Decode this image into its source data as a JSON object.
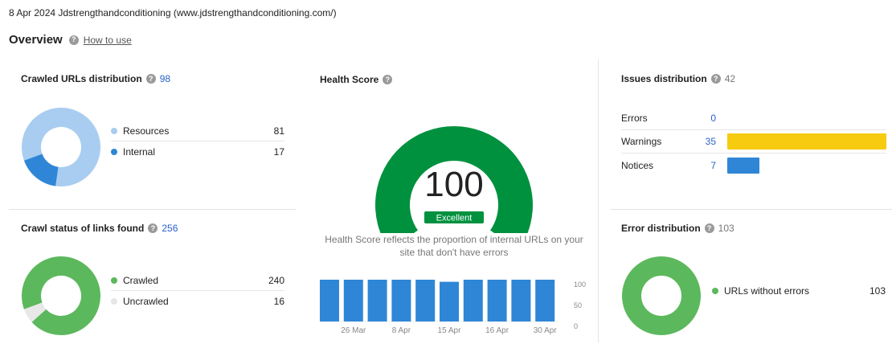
{
  "header": {
    "crawl_info": "8 Apr 2024 Jdstrengthandconditioning (www.jdstrengthandconditioning.com/)",
    "title": "Overview",
    "help_glyph": "?",
    "how_to_use": "How to use"
  },
  "crawled_urls": {
    "title": "Crawled URLs distribution",
    "count": "98",
    "items": [
      {
        "label": "Resources",
        "value": "81",
        "color": "#a9cdf0"
      },
      {
        "label": "Internal",
        "value": "17",
        "color": "#2f86d6"
      }
    ]
  },
  "crawl_status": {
    "title": "Crawl status of links found",
    "count": "256",
    "items": [
      {
        "label": "Crawled",
        "value": "240",
        "color": "#5cb85c"
      },
      {
        "label": "Uncrawled",
        "value": "16",
        "color": "#e8e8e8"
      }
    ]
  },
  "health": {
    "title": "Health Score",
    "score": "100",
    "badge": "Excellent",
    "description": "Health Score reflects the proportion of internal URLs on your site that don't have errors",
    "gauge_color": "#00913f",
    "badge_color": "#00913f",
    "history": {
      "values": [
        100,
        100,
        100,
        100,
        100,
        95,
        100,
        100,
        100,
        100
      ],
      "x_ticks": [
        "26 Mar",
        "8 Apr",
        "15 Apr",
        "16 Apr",
        "30 Apr"
      ],
      "y_ticks": [
        "100",
        "50",
        "0"
      ],
      "bar_color": "#2f86d6"
    }
  },
  "issues": {
    "title": "Issues distribution",
    "count": "42",
    "rows": [
      {
        "label": "Errors",
        "value": "0",
        "count": 0,
        "color": "#d9463e"
      },
      {
        "label": "Warnings",
        "value": "35",
        "count": 35,
        "color": "#f7cb0f"
      },
      {
        "label": "Notices",
        "value": "7",
        "count": 7,
        "color": "#2f86d6"
      }
    ]
  },
  "error_distribution": {
    "title": "Error distribution",
    "count": "103",
    "items": [
      {
        "label": "URLs without errors",
        "value": "103",
        "color": "#5cb85c"
      }
    ]
  },
  "chart_data": [
    {
      "type": "pie",
      "title": "Crawled URLs distribution",
      "categories": [
        "Resources",
        "Internal"
      ],
      "values": [
        81,
        17
      ]
    },
    {
      "type": "pie",
      "title": "Crawl status of links found",
      "categories": [
        "Crawled",
        "Uncrawled"
      ],
      "values": [
        240,
        16
      ]
    },
    {
      "type": "bar",
      "title": "Health Score",
      "categories": [
        "",
        "26 Mar",
        "",
        "8 Apr",
        "",
        "15 Apr",
        "",
        "16 Apr",
        "",
        "30 Apr"
      ],
      "values": [
        100,
        100,
        100,
        100,
        100,
        95,
        100,
        100,
        100,
        100
      ],
      "ylim": [
        0,
        100
      ]
    },
    {
      "type": "bar",
      "title": "Issues distribution",
      "categories": [
        "Errors",
        "Warnings",
        "Notices"
      ],
      "values": [
        0,
        35,
        7
      ]
    },
    {
      "type": "pie",
      "title": "Error distribution",
      "categories": [
        "URLs without errors"
      ],
      "values": [
        103
      ]
    }
  ]
}
